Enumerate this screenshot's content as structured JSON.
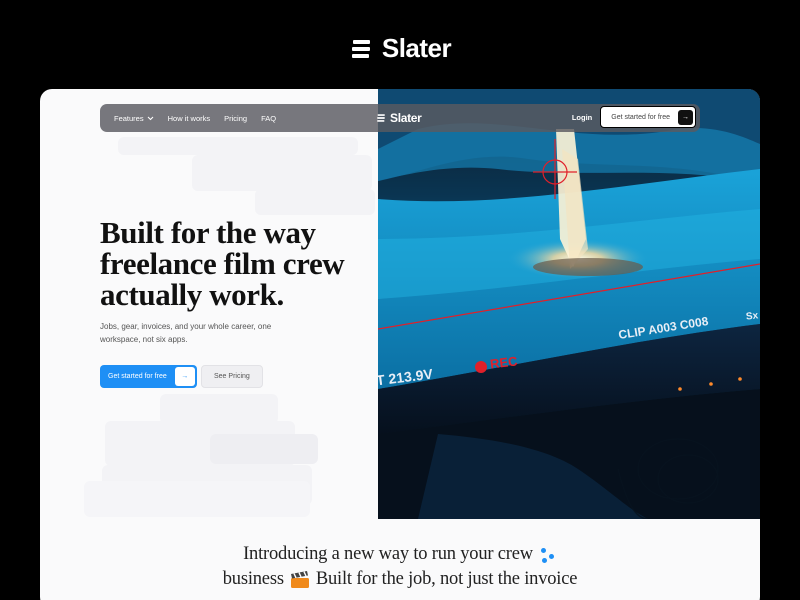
{
  "brand": {
    "name": "Slater"
  },
  "nav": {
    "items": [
      {
        "label": "Features",
        "has_dropdown": true
      },
      {
        "label": "How it works"
      },
      {
        "label": "Pricing"
      },
      {
        "label": "FAQ"
      }
    ],
    "brand": "Slater",
    "login": "Login",
    "cta": "Get started for free",
    "cta_icon": "arrow-right-icon"
  },
  "hero": {
    "headline": [
      "Built for the way",
      "freelance film crew",
      "actually work."
    ],
    "subtext": [
      "Jobs, gear, invoices, and your whole career, one",
      "workspace, not six apps."
    ],
    "primary_cta": "Get started for free",
    "secondary_cta": "See Pricing"
  },
  "hero_image": {
    "overlay_labels": {
      "clip": "CLIP A003 C008",
      "voltage": "T 213.9V",
      "rec": "REC",
      "corner": "Sx"
    }
  },
  "intro": {
    "line1": "Introducing a new way to run your crew",
    "line2_a": "business",
    "line2_b": "Built for the job, not just the invoice"
  },
  "colors": {
    "accent": "#1e8ff5",
    "rec": "#e0202a",
    "background": "#000000",
    "card": "#fafafb"
  }
}
